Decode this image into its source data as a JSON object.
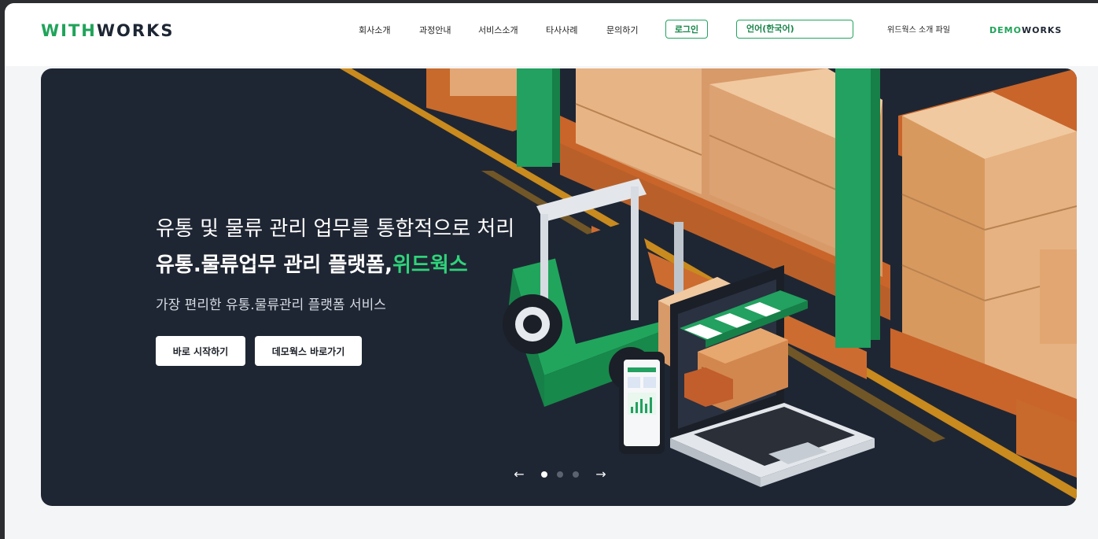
{
  "header": {
    "logo": {
      "part1": "WITH",
      "part2": "WORKS"
    },
    "nav": [
      "회사소개",
      "과정안내",
      "서비스소개",
      "타사사례",
      "문의하기"
    ],
    "login_label": "로그인",
    "language_value": "언어(한국어)",
    "intro_file_label": "위드웍스 소개 파일",
    "demo_logo": {
      "part1": "DEMO",
      "part2": "WORKS"
    }
  },
  "hero": {
    "line1": "유통 및 물류 관리 업무를 통합적으로 처리",
    "line2_main": "유통.물류업무 관리 플랫폼,",
    "line2_accent": "위드웍스",
    "subtitle": "가장 편리한 유통.물류관리 플랫폼 서비스",
    "start_button": "바로 시작하기",
    "demo_button": "데모웍스 바로가기"
  },
  "slider": {
    "prev_icon": "arrow-left-icon",
    "next_icon": "arrow-right-icon",
    "total": 3,
    "active": 1
  },
  "colors": {
    "brand_green": "#20a35a",
    "hero_bg": "#1f2633",
    "dark_text": "#1d2633"
  }
}
